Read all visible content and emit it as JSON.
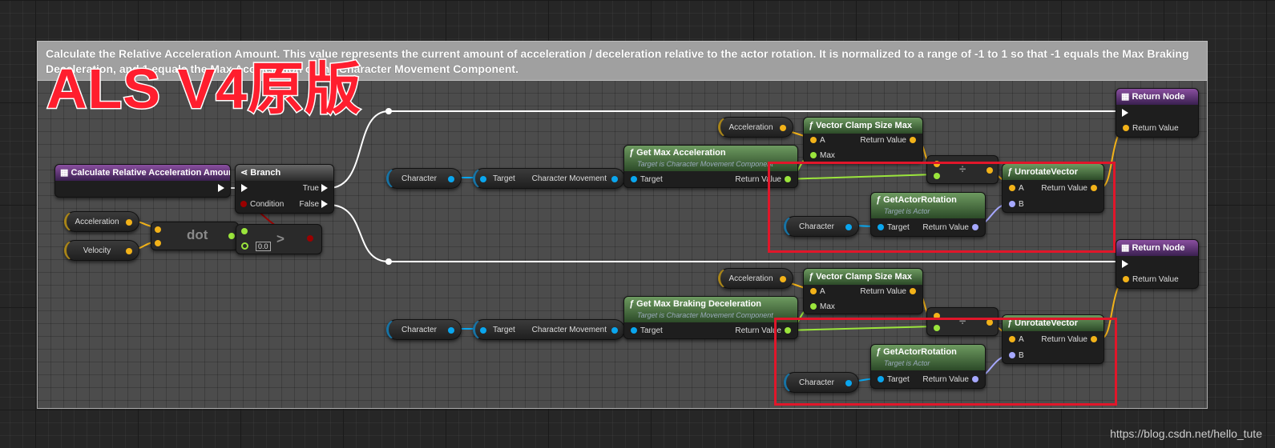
{
  "comment": {
    "text": "Calculate the Relative Acceleration Amount. This value represents the current amount of acceleration / deceleration relative to the actor rotation. It is normalized to a range of -1 to 1 so that -1 equals the Max Braking Deceleration, and 1 equals the Max Acceleration of the Character Movement Component."
  },
  "overlay_title": "ALS V4原版",
  "watermark": "https://blog.csdn.net/hello_tute",
  "entry": {
    "title": "Calculate Relative Acceleration Amount"
  },
  "branch": {
    "title": "Branch",
    "condition": "Condition",
    "true_label": "True",
    "false_label": "False"
  },
  "dot_node": {
    "label": "dot"
  },
  "compare_node": {
    "label": ">",
    "default_value": "0.0"
  },
  "variables": {
    "acceleration": "Acceleration",
    "velocity": "Velocity",
    "character": "Character"
  },
  "target_cast": {
    "target": "Target",
    "character_movement": "Character Movement"
  },
  "get_max_accel": {
    "title": "Get Max Acceleration",
    "subtitle": "Target is Character Movement Component",
    "target": "Target",
    "return": "Return Value"
  },
  "get_max_braking": {
    "title": "Get Max Braking Deceleration",
    "subtitle": "Target is Character Movement Component",
    "target": "Target",
    "return": "Return Value"
  },
  "clamp": {
    "title": "Vector Clamp Size Max",
    "a": "A",
    "max": "Max",
    "return": "Return Value"
  },
  "divide": {
    "label": "÷"
  },
  "get_actor_rotation": {
    "title": "GetActorRotation",
    "subtitle": "Target is Actor",
    "target": "Target",
    "return": "Return Value"
  },
  "unrotate": {
    "title": "UnrotateVector",
    "a": "A",
    "b": "B",
    "return": "Return Value"
  },
  "return_node": {
    "title": "Return Node",
    "return": "Return Value"
  },
  "colors": {
    "float": "#9be53c",
    "vector": "#f2b219",
    "object": "#0aa6ee",
    "rotator": "#a6a8ff",
    "bool": "#9a0000",
    "highlight": "#e1162a"
  }
}
